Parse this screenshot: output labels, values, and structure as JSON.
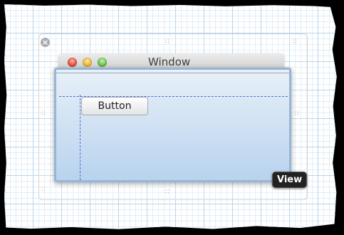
{
  "window": {
    "title": "Window"
  },
  "button": {
    "label": "Button"
  },
  "inspector_badge": {
    "label": "View"
  },
  "tray_close": {
    "symbol": "×"
  },
  "handles": {
    "dots": "∶∶"
  },
  "colors": {
    "guide": "#4c6ad8",
    "content_top": "#e8f0f8",
    "content_bottom": "#b8d3ee"
  }
}
